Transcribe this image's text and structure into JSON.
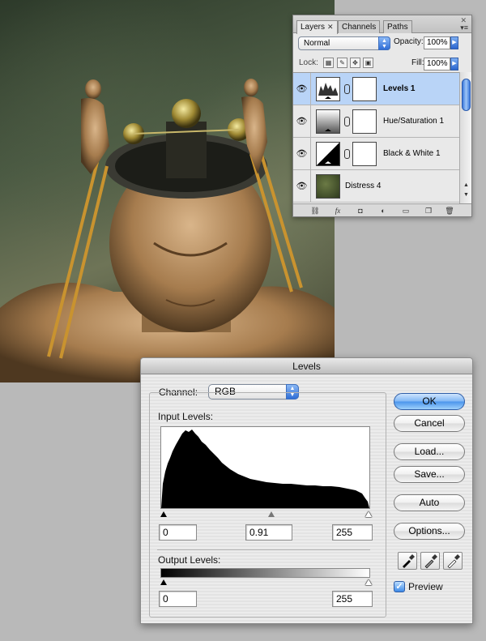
{
  "layers_panel": {
    "tabs": [
      {
        "label": "Layers",
        "close": "✕"
      },
      {
        "label": "Channels"
      },
      {
        "label": "Paths"
      }
    ],
    "blend_mode": "Normal",
    "opacity_label": "Opacity:",
    "opacity_value": "100%",
    "lock_label": "Lock:",
    "fill_label": "Fill:",
    "fill_value": "100%",
    "layers": [
      {
        "name": "Levels 1",
        "selected": true
      },
      {
        "name": "Hue/Saturation 1",
        "selected": false
      },
      {
        "name": "Black & White 1",
        "selected": false
      },
      {
        "name": "Distress 4",
        "selected": false
      }
    ],
    "footer_fx": "fx"
  },
  "levels_dialog": {
    "title": "Levels",
    "channel_label": "Channel:",
    "channel_value": "RGB",
    "input_levels_label": "Input Levels:",
    "input_black": "0",
    "input_gamma": "0.91",
    "input_white": "255",
    "output_levels_label": "Output Levels:",
    "output_black": "0",
    "output_white": "255",
    "buttons": {
      "ok": "OK",
      "cancel": "Cancel",
      "load": "Load...",
      "save": "Save...",
      "auto": "Auto",
      "options": "Options..."
    },
    "preview_label": "Preview",
    "preview_checked": true
  },
  "colors": {
    "selection": "#b9d4f7",
    "aqua_blue": "#4a94ec"
  }
}
